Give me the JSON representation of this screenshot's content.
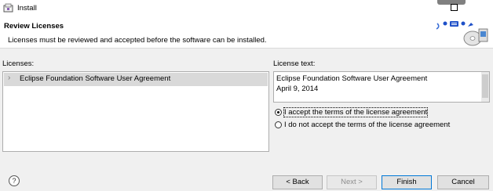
{
  "window": {
    "title": "Install"
  },
  "header": {
    "title": "Review Licenses",
    "description": "Licenses must be reviewed and accepted before the software can be installed."
  },
  "licenses": {
    "label": "Licenses:",
    "items": [
      {
        "label": "Eclipse Foundation Software User Agreement"
      }
    ]
  },
  "license_text": {
    "label": "License text:",
    "lines": [
      "Eclipse Foundation Software User Agreement",
      "April 9, 2014"
    ]
  },
  "options": {
    "accept": "I accept the terms of the license agreement",
    "decline": "I do not accept the terms of the license agreement",
    "selected": "accept"
  },
  "buttons": {
    "help": "?",
    "back": "< Back",
    "next": "Next >",
    "finish": "Finish",
    "cancel": "Cancel"
  },
  "colors": {
    "selection": "#d9d9d9",
    "default_button_border": "#0078d7",
    "background": "#f0f0f0"
  }
}
